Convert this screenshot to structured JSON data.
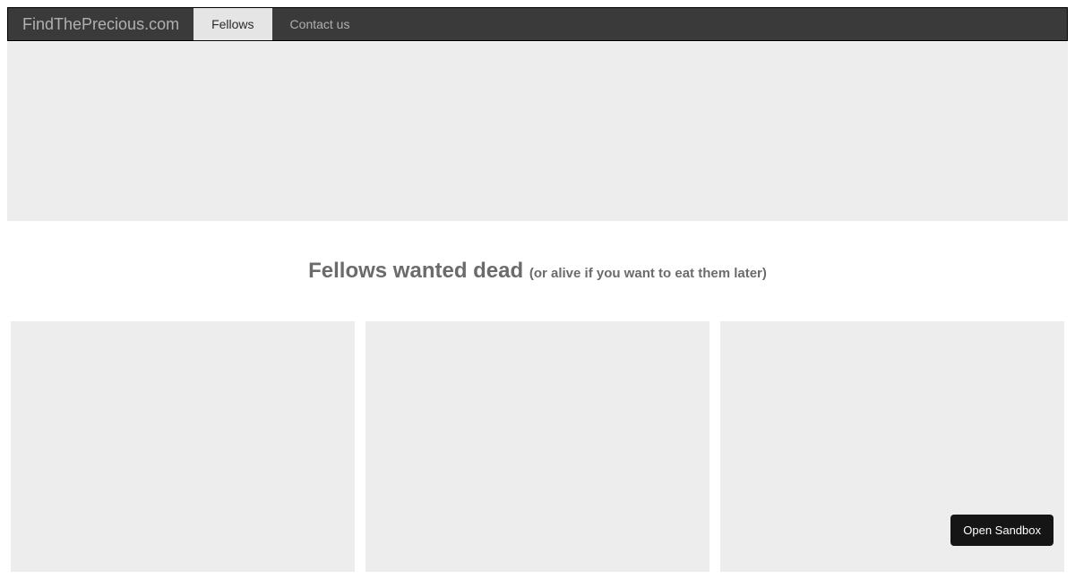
{
  "nav": {
    "brand": "FindThePrecious.com",
    "items": [
      {
        "label": "Fellows",
        "active": true
      },
      {
        "label": "Contact us",
        "active": false
      }
    ]
  },
  "heading": {
    "main": "Fellows wanted dead ",
    "sub": "(or alive if you want to eat them later)"
  },
  "sandbox_button": "Open Sandbox"
}
